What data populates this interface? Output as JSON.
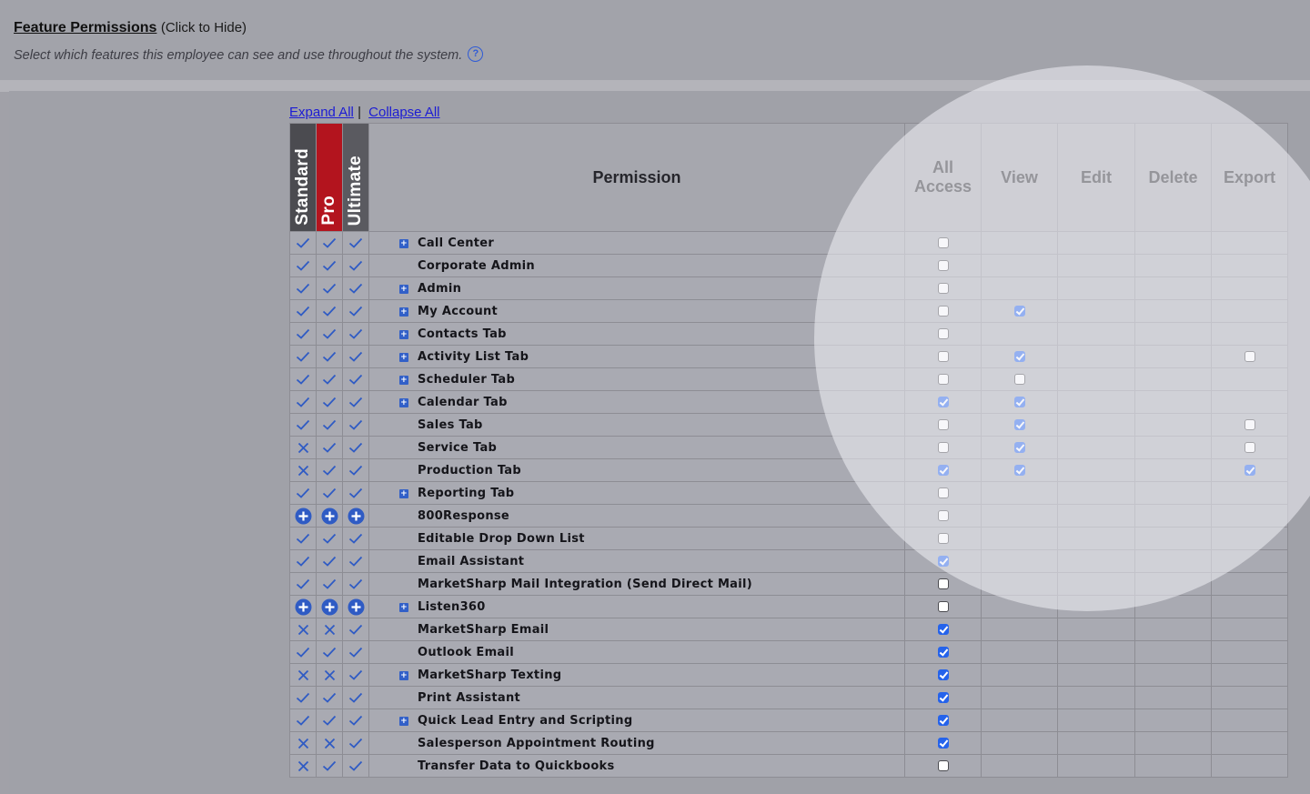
{
  "header": {
    "title": "Feature Permissions",
    "hide_label": "(Click to Hide)",
    "subtitle": "Select which features this employee can see and use throughout the system.",
    "help_icon": "?"
  },
  "toolbar": {
    "expand_all": "Expand All",
    "separator": "|",
    "collapse_all": "Collapse All"
  },
  "columns": {
    "standard": "Standard",
    "pro": "Pro",
    "ultimate": "Ultimate",
    "permission": "Permission",
    "all_access": "All Access",
    "view": "View",
    "edit": "Edit",
    "delete": "Delete",
    "export": "Export"
  },
  "colors": {
    "check_icon": "#2f5bc4",
    "pro_header": "#b3141e",
    "checked_box": "#2563eb"
  },
  "rows": [
    {
      "name": "Call Center",
      "expand": true,
      "tiers": [
        "check",
        "check",
        "check"
      ],
      "all": false,
      "view": null,
      "export": null
    },
    {
      "name": "Corporate Admin",
      "expand": false,
      "tiers": [
        "check",
        "check",
        "check"
      ],
      "all": false,
      "view": null,
      "export": null
    },
    {
      "name": "Admin",
      "expand": true,
      "tiers": [
        "check",
        "check",
        "check"
      ],
      "all": false,
      "view": null,
      "export": null
    },
    {
      "name": "My Account",
      "expand": true,
      "tiers": [
        "check",
        "check",
        "check"
      ],
      "all": false,
      "view": true,
      "export": null
    },
    {
      "name": "Contacts Tab",
      "expand": true,
      "tiers": [
        "check",
        "check",
        "check"
      ],
      "all": false,
      "view": null,
      "export": null
    },
    {
      "name": "Activity List Tab",
      "expand": true,
      "tiers": [
        "check",
        "check",
        "check"
      ],
      "all": false,
      "view": true,
      "export": false
    },
    {
      "name": "Scheduler Tab",
      "expand": true,
      "tiers": [
        "check",
        "check",
        "check"
      ],
      "all": false,
      "view": false,
      "export": null
    },
    {
      "name": "Calendar Tab",
      "expand": true,
      "tiers": [
        "check",
        "check",
        "check"
      ],
      "all": true,
      "view": true,
      "export": null
    },
    {
      "name": "Sales Tab",
      "expand": false,
      "tiers": [
        "check",
        "check",
        "check"
      ],
      "all": false,
      "view": true,
      "export": false
    },
    {
      "name": "Service Tab",
      "expand": false,
      "tiers": [
        "cross",
        "check",
        "check"
      ],
      "all": false,
      "view": true,
      "export": false
    },
    {
      "name": "Production Tab",
      "expand": false,
      "tiers": [
        "cross",
        "check",
        "check"
      ],
      "all": true,
      "view": true,
      "export": true
    },
    {
      "name": "Reporting Tab",
      "expand": true,
      "tiers": [
        "check",
        "check",
        "check"
      ],
      "all": false,
      "view": null,
      "export": null
    },
    {
      "name": "800Response",
      "expand": false,
      "tiers": [
        "plus",
        "plus",
        "plus"
      ],
      "all": false,
      "view": null,
      "export": null
    },
    {
      "name": "Editable Drop Down List",
      "expand": false,
      "tiers": [
        "check",
        "check",
        "check"
      ],
      "all": false,
      "view": null,
      "export": null
    },
    {
      "name": "Email Assistant",
      "expand": false,
      "tiers": [
        "check",
        "check",
        "check"
      ],
      "all": true,
      "view": null,
      "export": null
    },
    {
      "name": "MarketSharp Mail Integration (Send Direct Mail)",
      "expand": false,
      "tiers": [
        "check",
        "check",
        "check"
      ],
      "all": false,
      "view": null,
      "export": null
    },
    {
      "name": "Listen360",
      "expand": true,
      "tiers": [
        "plus",
        "plus",
        "plus"
      ],
      "all": false,
      "view": null,
      "export": null
    },
    {
      "name": "MarketSharp Email",
      "expand": false,
      "tiers": [
        "cross",
        "cross",
        "check"
      ],
      "all": true,
      "view": null,
      "export": null
    },
    {
      "name": "Outlook Email",
      "expand": false,
      "tiers": [
        "check",
        "check",
        "check"
      ],
      "all": true,
      "view": null,
      "export": null
    },
    {
      "name": "MarketSharp Texting",
      "expand": true,
      "tiers": [
        "cross",
        "cross",
        "check"
      ],
      "all": true,
      "view": null,
      "export": null
    },
    {
      "name": "Print Assistant",
      "expand": false,
      "tiers": [
        "check",
        "check",
        "check"
      ],
      "all": true,
      "view": null,
      "export": null
    },
    {
      "name": "Quick Lead Entry and Scripting",
      "expand": true,
      "tiers": [
        "check",
        "check",
        "check"
      ],
      "all": true,
      "view": null,
      "export": null
    },
    {
      "name": "Salesperson Appointment Routing",
      "expand": false,
      "tiers": [
        "cross",
        "cross",
        "check"
      ],
      "all": true,
      "view": null,
      "export": null
    },
    {
      "name": "Transfer Data to Quickbooks",
      "expand": false,
      "tiers": [
        "cross",
        "check",
        "check"
      ],
      "all": false,
      "view": null,
      "export": null
    }
  ]
}
